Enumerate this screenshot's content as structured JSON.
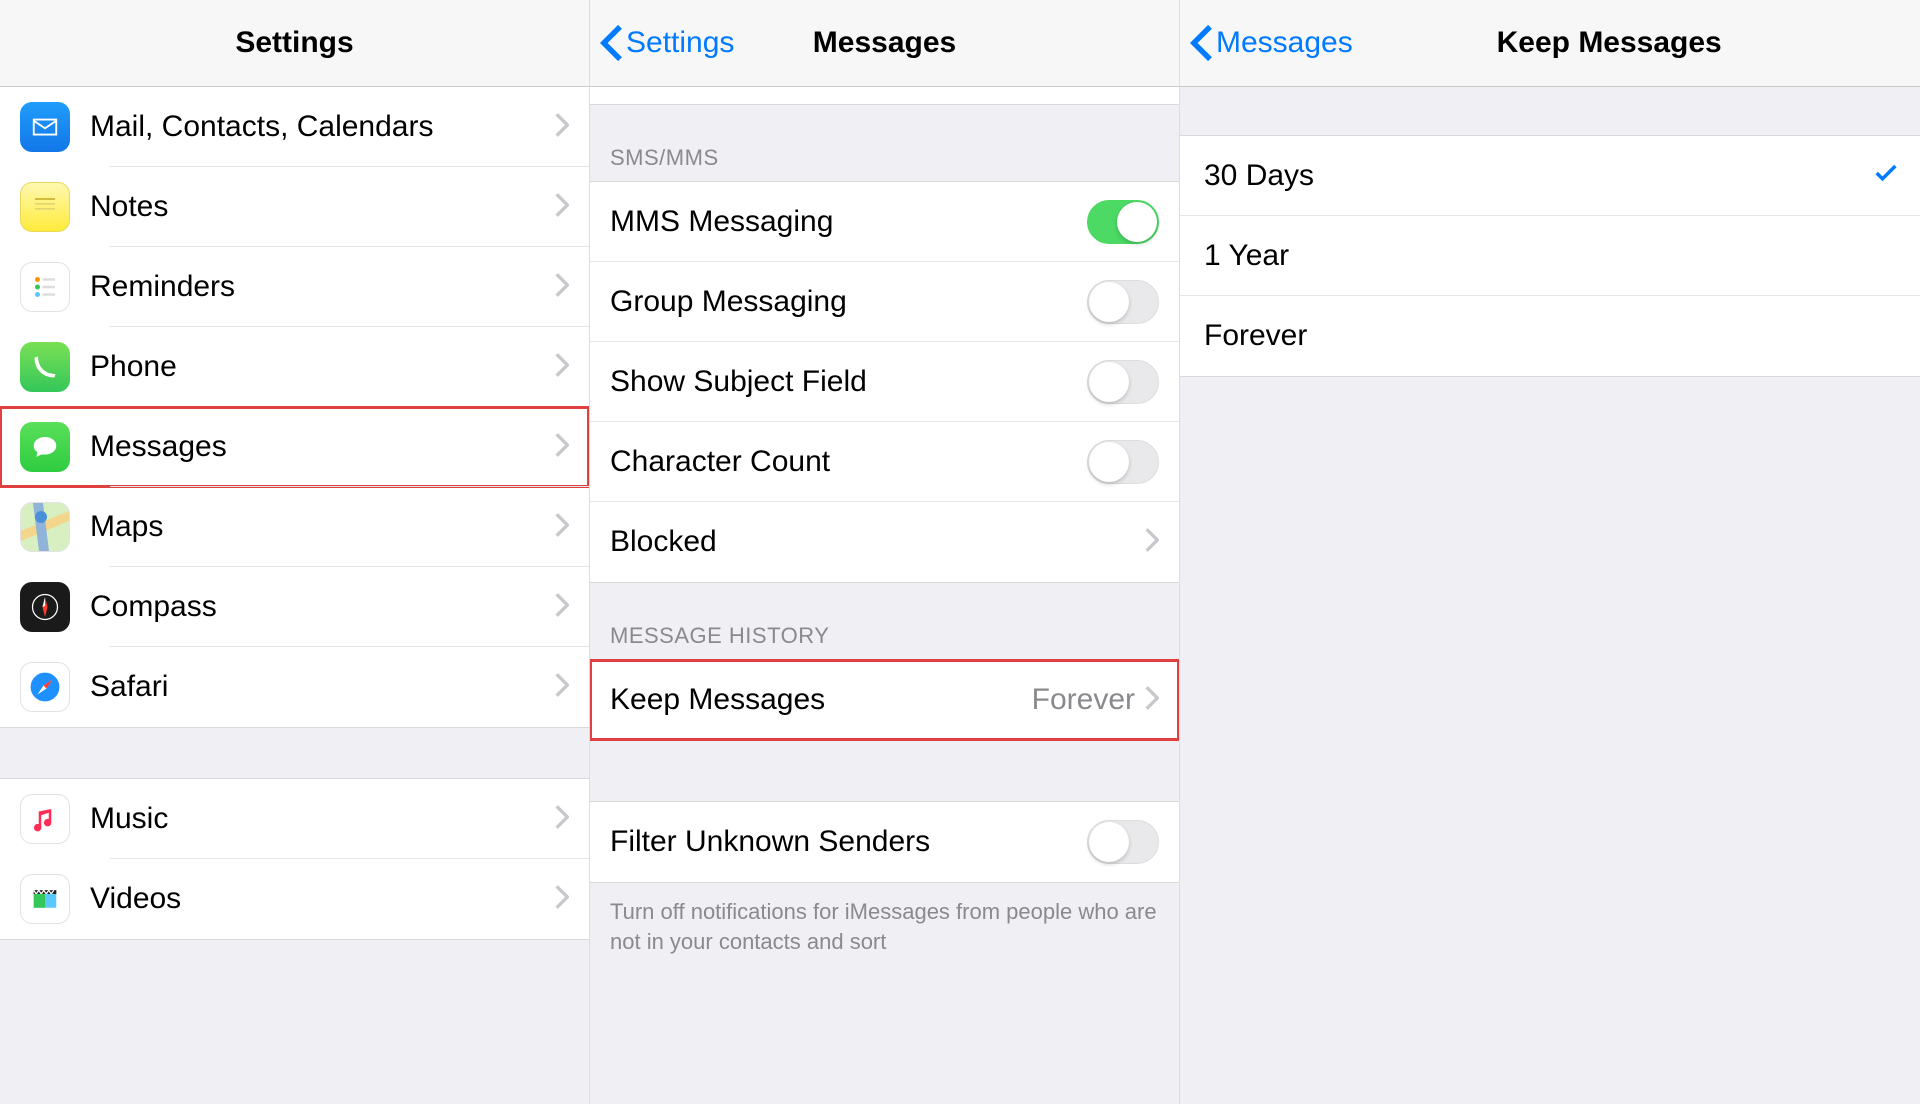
{
  "panel1": {
    "title": "Settings",
    "group1": [
      {
        "id": "mail",
        "label": "Mail, Contacts, Calendars",
        "icon": "mail-icon"
      },
      {
        "id": "notes",
        "label": "Notes",
        "icon": "notes-icon"
      },
      {
        "id": "reminders",
        "label": "Reminders",
        "icon": "reminders-icon"
      },
      {
        "id": "phone",
        "label": "Phone",
        "icon": "phone-icon"
      },
      {
        "id": "messages",
        "label": "Messages",
        "icon": "messages-icon",
        "highlight": true
      },
      {
        "id": "maps",
        "label": "Maps",
        "icon": "maps-icon"
      },
      {
        "id": "compass",
        "label": "Compass",
        "icon": "compass-icon"
      },
      {
        "id": "safari",
        "label": "Safari",
        "icon": "safari-icon"
      }
    ],
    "group2": [
      {
        "id": "music",
        "label": "Music",
        "icon": "music-icon"
      },
      {
        "id": "videos",
        "label": "Videos",
        "icon": "videos-icon"
      }
    ]
  },
  "panel2": {
    "back": "Settings",
    "title": "Messages",
    "section_sms": "SMS/MMS",
    "toggles": {
      "mms": {
        "label": "MMS Messaging",
        "on": true
      },
      "group": {
        "label": "Group Messaging",
        "on": false
      },
      "subject": {
        "label": "Show Subject Field",
        "on": false
      },
      "char": {
        "label": "Character Count",
        "on": false
      }
    },
    "blocked": "Blocked",
    "section_history": "MESSAGE HISTORY",
    "keep": {
      "label": "Keep Messages",
      "value": "Forever",
      "highlight": true
    },
    "filter": {
      "label": "Filter Unknown Senders",
      "on": false
    },
    "footer": "Turn off notifications for iMessages from people who are not in your contacts and sort"
  },
  "panel3": {
    "back": "Messages",
    "title": "Keep Messages",
    "options": [
      {
        "label": "30 Days",
        "selected": true
      },
      {
        "label": "1 Year",
        "selected": false
      },
      {
        "label": "Forever",
        "selected": false
      }
    ]
  }
}
